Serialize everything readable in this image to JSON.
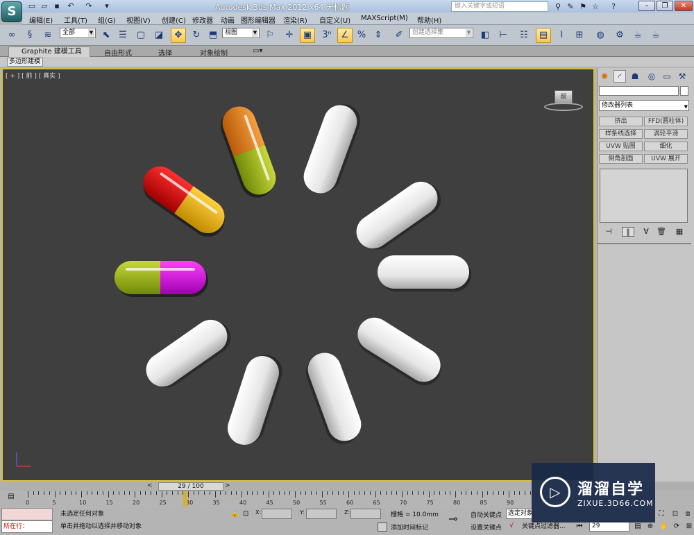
{
  "window": {
    "title": "Autodesk 3ds Max  2012 x64      无标题",
    "search_placeholder": "键入关键字或短语",
    "app_icon": "3ds-max-logo-icon"
  },
  "menubar": [
    "编辑(E)",
    "工具(T)",
    "组(G)",
    "视图(V)",
    "创建(C)",
    "修改器",
    "动画",
    "图形编辑器",
    "渲染(R)",
    "自定义(U)",
    "MAXScript(M)",
    "帮助(H)"
  ],
  "toolbar": {
    "filter_value": "全部",
    "refcoord_value": "视图",
    "snap_label": "3",
    "named_selection_placeholder": "创建选择集"
  },
  "ribbon": {
    "tabs": [
      "Graphite 建模工具",
      "自由形式",
      "选择",
      "对象绘制"
    ],
    "active_tab": "Graphite 建模工具",
    "subtab": "多边形建模"
  },
  "viewport": {
    "label": "[ + ] [ 前 ] [ 真实 ]",
    "viewcube_face": "前",
    "colors": {
      "border": "#d7c040",
      "background": "#3f3f3f"
    }
  },
  "command_panel": {
    "modifier_list": "修改器列表",
    "buttons": [
      "挤出",
      "FFD(圆柱体)",
      "样条线选择",
      "涡轮平滑",
      "UVW 贴图",
      "细化",
      "倒角剖面",
      "UVW 展开"
    ]
  },
  "timeline": {
    "slider_label": "29 / 100",
    "ticks": [
      0,
      5,
      10,
      15,
      20,
      25,
      30,
      35,
      40,
      45,
      50,
      55,
      60,
      65,
      70,
      75,
      80,
      85,
      90
    ],
    "current_frame": 29
  },
  "status": {
    "left_top": "",
    "left_bottom": "所在行：",
    "selection": "未选定任何对象",
    "prompt": "单击并拖动以选择并移动对象",
    "x_label": "X:",
    "y_label": "Y:",
    "z_label": "Z:",
    "grid": "栅格 = 10.0mm",
    "add_time_tag": "添加时间标记",
    "auto_key": "自动关键点",
    "set_key": "设置关键点",
    "selected_dropdown": "选定对象",
    "key_filters": "关键点过滤器...",
    "frame_value": "29"
  },
  "watermark": {
    "title": "溜溜自学",
    "subtitle": "ZIXUE.3D66.COM"
  }
}
